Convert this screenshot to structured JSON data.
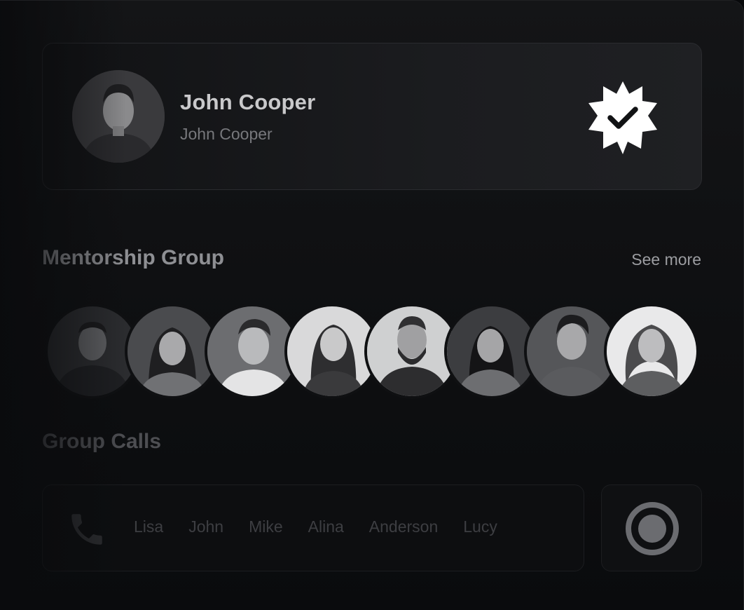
{
  "profile": {
    "name": "John Cooper",
    "handle": "John Cooper",
    "verified_icon": "verified-badge-icon"
  },
  "mentorship": {
    "title": "Mentorship Group",
    "see_more_label": "See more",
    "members": [
      {
        "icon": "member-avatar"
      },
      {
        "icon": "member-avatar"
      },
      {
        "icon": "member-avatar"
      },
      {
        "icon": "member-avatar"
      },
      {
        "icon": "member-avatar"
      },
      {
        "icon": "member-avatar"
      },
      {
        "icon": "member-avatar"
      },
      {
        "icon": "member-avatar"
      }
    ]
  },
  "group_calls": {
    "title": "Group Calls",
    "call_icon": "phone-icon",
    "participants": [
      "Lisa",
      "John",
      "Mike",
      "Alina",
      "Anderson",
      "Lucy"
    ],
    "record_icon": "record-icon"
  },
  "colors": {
    "background": "#0e0f11",
    "card": "#1b1c1f",
    "text_primary": "#c9c9cb",
    "text_secondary": "#77787c",
    "badge": "#ffffff"
  }
}
